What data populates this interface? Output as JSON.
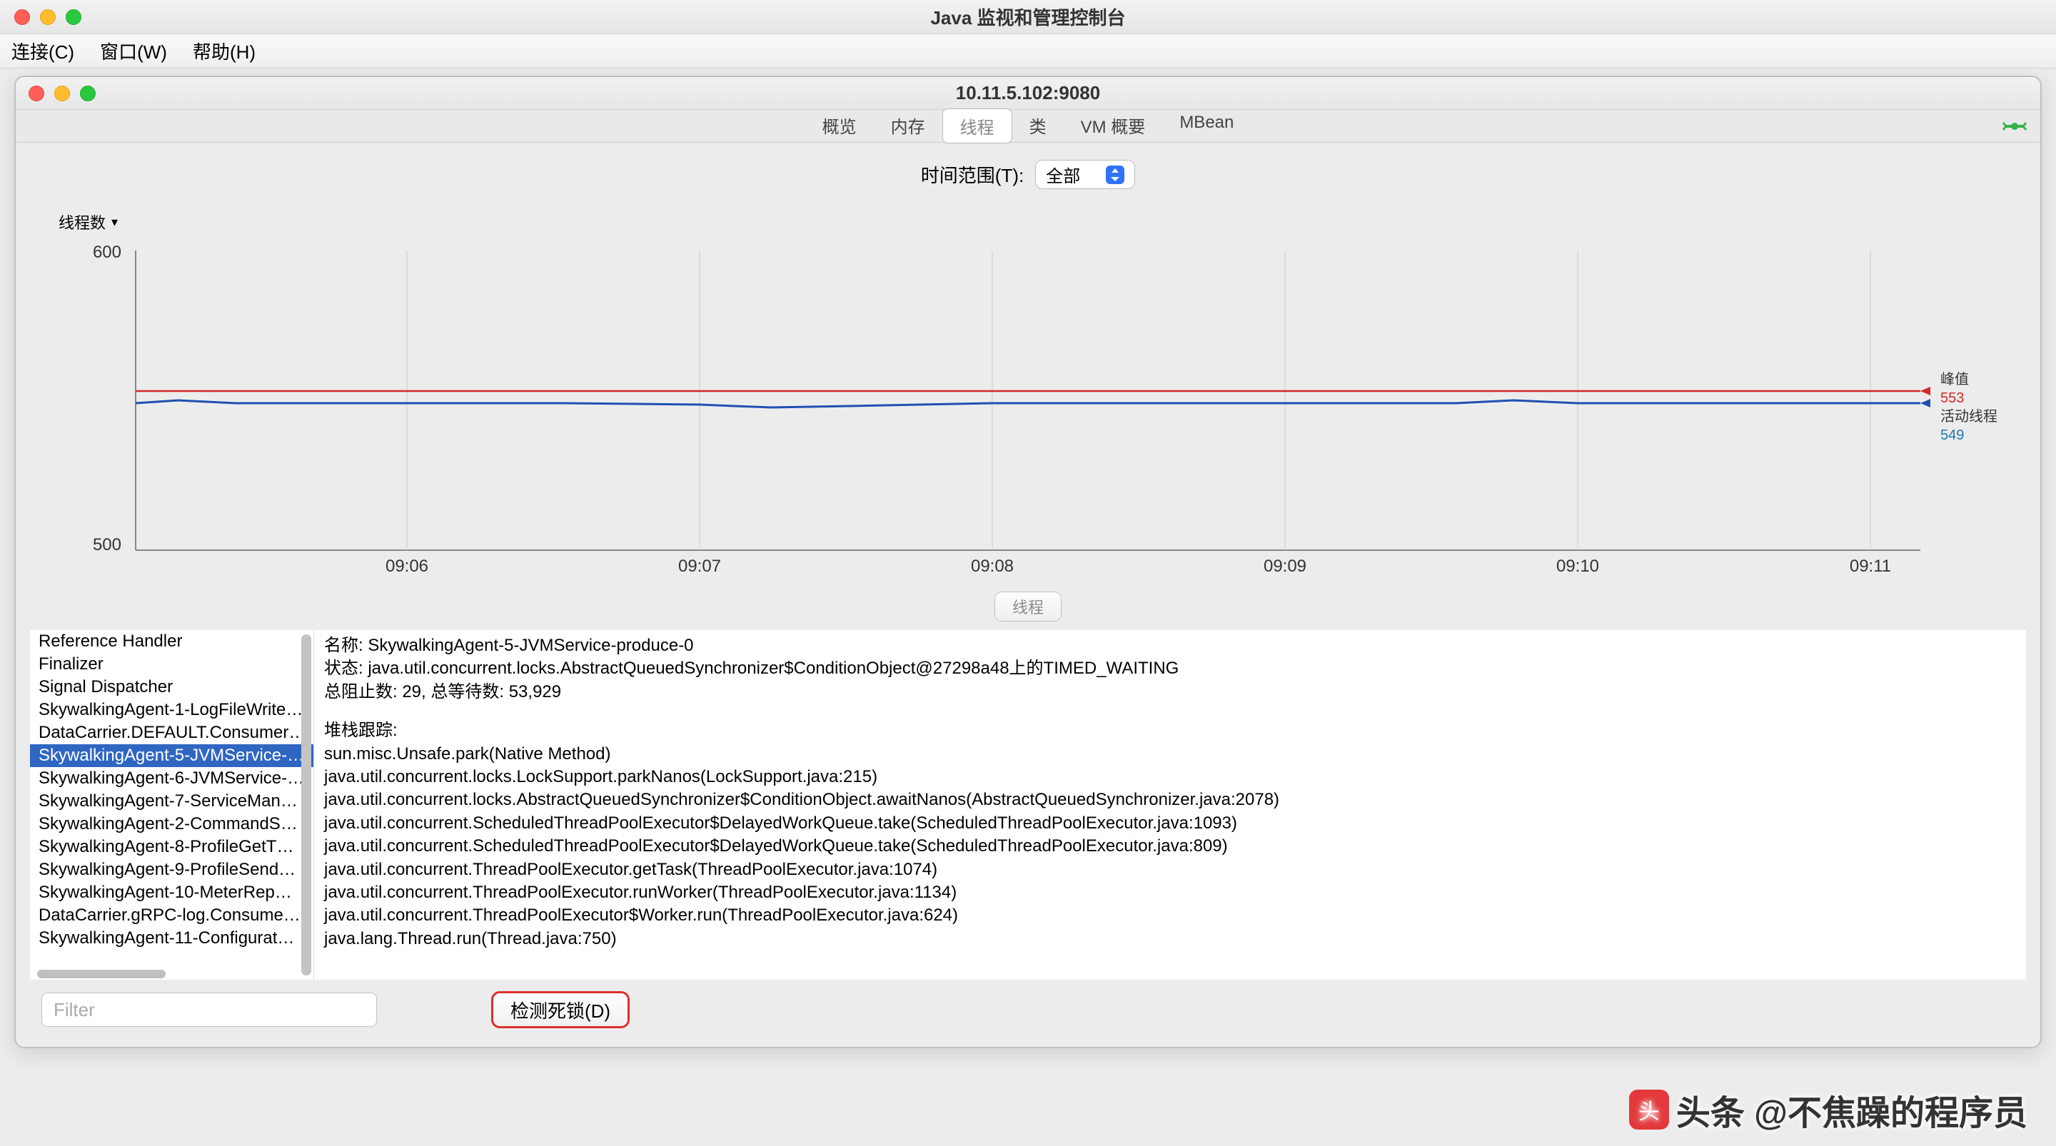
{
  "window": {
    "title": "Java 监视和管理控制台"
  },
  "menubar": {
    "connect": "连接(C)",
    "window": "窗口(W)",
    "help": "帮助(H)"
  },
  "inner": {
    "title": "10.11.5.102:9080"
  },
  "tabs": {
    "overview": "概览",
    "memory": "内存",
    "threads": "线程",
    "classes": "类",
    "vm": "VM 概要",
    "mbean": "MBean"
  },
  "time_range": {
    "label": "时间范围(T):",
    "value": "全部"
  },
  "chart": {
    "title": "线程数",
    "y_min": "500",
    "y_max": "600",
    "x_ticks": [
      "09:06",
      "09:07",
      "09:08",
      "09:09",
      "09:10",
      "09:11"
    ],
    "legend": {
      "peak_label": "峰值",
      "peak_value": "553",
      "live_label": "活动线程",
      "live_value": "549"
    }
  },
  "chart_data": {
    "type": "line",
    "title": "线程数",
    "xlabel": "",
    "ylabel": "",
    "ylim": [
      500,
      600
    ],
    "x": [
      "09:06",
      "09:07",
      "09:08",
      "09:09",
      "09:10",
      "09:11"
    ],
    "series": [
      {
        "name": "峰值",
        "color": "#d62728",
        "values": [
          553,
          553,
          553,
          553,
          553,
          553
        ]
      },
      {
        "name": "活动线程",
        "color": "#1f77b4",
        "values": [
          549,
          549,
          548,
          549,
          549,
          549
        ]
      }
    ]
  },
  "section_header": "线程",
  "threads": {
    "items": [
      "Reference Handler",
      "Finalizer",
      "Signal Dispatcher",
      "SkywalkingAgent-1-LogFileWrite…",
      "DataCarrier.DEFAULT.Consumer…",
      "SkywalkingAgent-5-JVMService-…",
      "SkywalkingAgent-6-JVMService-…",
      "SkywalkingAgent-7-ServiceMan…",
      "SkywalkingAgent-2-CommandS…",
      "SkywalkingAgent-8-ProfileGetT…",
      "SkywalkingAgent-9-ProfileSend…",
      "SkywalkingAgent-10-MeterRep…",
      "DataCarrier.gRPC-log.Consume…",
      "SkywalkingAgent-11-Configurat…"
    ],
    "selected_index": 5
  },
  "detail": {
    "name_label": "名称: ",
    "name_value": "SkywalkingAgent-5-JVMService-produce-0",
    "state_label": "状态: ",
    "state_value": "java.util.concurrent.locks.AbstractQueuedSynchronizer$ConditionObject@27298a48上的TIMED_WAITING",
    "blocked_label": "总阻止数: 29, 总等待数: 53,929",
    "stack_label": "堆栈跟踪:",
    "stack": [
      "sun.misc.Unsafe.park(Native Method)",
      "java.util.concurrent.locks.LockSupport.parkNanos(LockSupport.java:215)",
      "java.util.concurrent.locks.AbstractQueuedSynchronizer$ConditionObject.awaitNanos(AbstractQueuedSynchronizer.java:2078)",
      "java.util.concurrent.ScheduledThreadPoolExecutor$DelayedWorkQueue.take(ScheduledThreadPoolExecutor.java:1093)",
      "java.util.concurrent.ScheduledThreadPoolExecutor$DelayedWorkQueue.take(ScheduledThreadPoolExecutor.java:809)",
      "java.util.concurrent.ThreadPoolExecutor.getTask(ThreadPoolExecutor.java:1074)",
      "java.util.concurrent.ThreadPoolExecutor.runWorker(ThreadPoolExecutor.java:1134)",
      "java.util.concurrent.ThreadPoolExecutor$Worker.run(ThreadPoolExecutor.java:624)",
      "java.lang.Thread.run(Thread.java:750)"
    ]
  },
  "filter": {
    "placeholder": "Filter"
  },
  "deadlock_button": "检测死锁(D)",
  "watermark": "头条 @不焦躁的程序员"
}
